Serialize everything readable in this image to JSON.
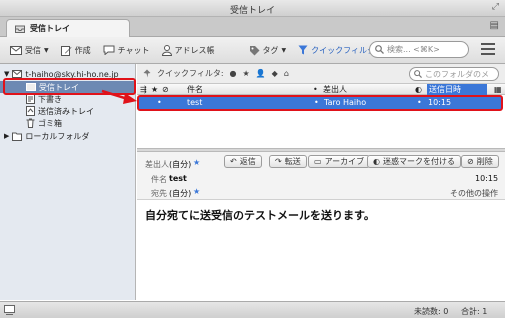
{
  "window": {
    "title": "受信トレイ"
  },
  "tab": {
    "label": "受信トレイ"
  },
  "toolbar": {
    "receive": "受信",
    "compose": "作成",
    "chat": "チャット",
    "address_book": "アドレス帳",
    "tag": "タグ",
    "quick_filter": "クイックフィルタ",
    "search_placeholder": "検索... <⌘K>"
  },
  "sidebar": {
    "account": "t-haiho@sky.hi-ho.ne.jp",
    "folders": [
      "受信トレイ",
      "下書き",
      "送信済みトレイ",
      "ゴミ箱"
    ],
    "local_folders": "ローカルフォルダ"
  },
  "quick_filter_bar": {
    "label": "クイックフィルタ:",
    "search_placeholder": "このフォルダのメ"
  },
  "columns": {
    "subject": "件名",
    "sender": "差出人",
    "date": "送信日時"
  },
  "messages": [
    {
      "subject": "test",
      "sender": "Taro Haiho",
      "date": "10:15",
      "selected": true
    }
  ],
  "header": {
    "from_label": "差出人",
    "from_value": "(自分)",
    "subject_label": "件名",
    "subject_value": "test",
    "to_label": "宛先",
    "to_value": "(自分)",
    "time": "10:15",
    "other_actions": "その他の操作",
    "reply": "返信",
    "forward": "転送",
    "archive": "アーカイブ",
    "junk": "迷惑マークを付ける",
    "delete": "削除"
  },
  "body_text": "自分宛てに送受信のテストメールを送ります。",
  "status": {
    "unread": "未読数: 0",
    "total": "合計: 1"
  },
  "colors": {
    "selection": "#3b77d8",
    "sidebar_selection": "#6d89b3",
    "annotation_red": "#e0121a"
  }
}
